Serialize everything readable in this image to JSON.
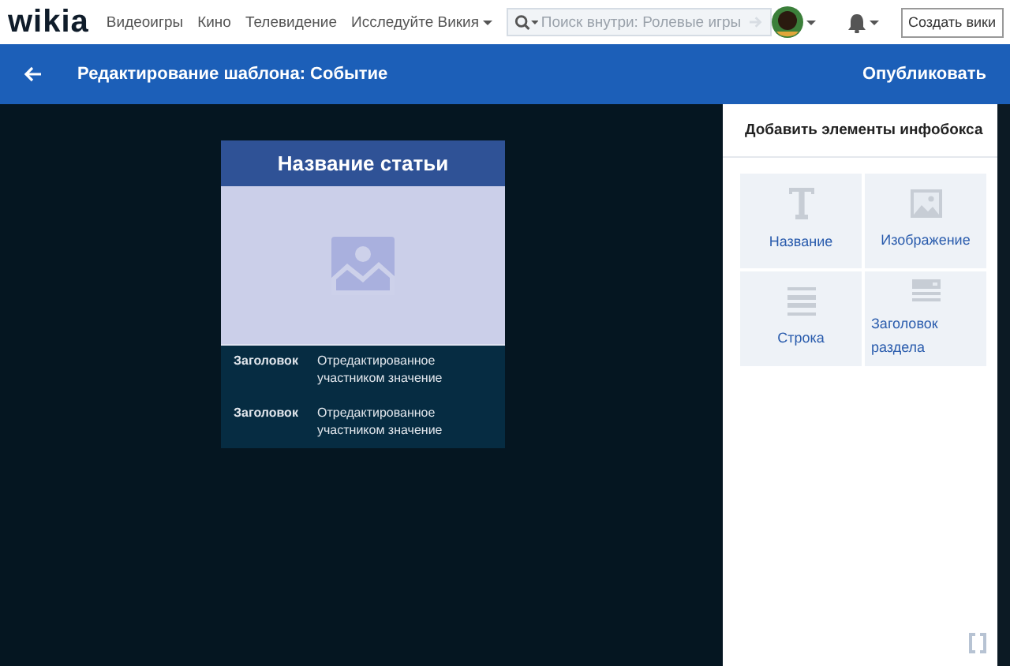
{
  "nav": {
    "logo": "wikia",
    "links": [
      "Видеоигры",
      "Кино",
      "Телевидение",
      "Исследуйте Викия"
    ],
    "search": {
      "placeholder": "Поиск внутри: Ролевые игры"
    },
    "create_button": "Создать вики"
  },
  "editor_bar": {
    "title": "Редактирование шаблона: Событие",
    "publish": "Опубликовать"
  },
  "infobox": {
    "title": "Название статьи",
    "rows": [
      {
        "label": "Заголовок",
        "value": "Отредактированное участником значение"
      },
      {
        "label": "Заголовок",
        "value": "Отредактированное участником значение"
      }
    ]
  },
  "panel": {
    "heading": "Добавить элементы инфобокса",
    "tiles": [
      {
        "kind": "title",
        "label": "Название"
      },
      {
        "kind": "image",
        "label": "Изображение"
      },
      {
        "kind": "row",
        "label": "Строка"
      },
      {
        "kind": "header",
        "label": "Заголовок раздела"
      }
    ]
  }
}
